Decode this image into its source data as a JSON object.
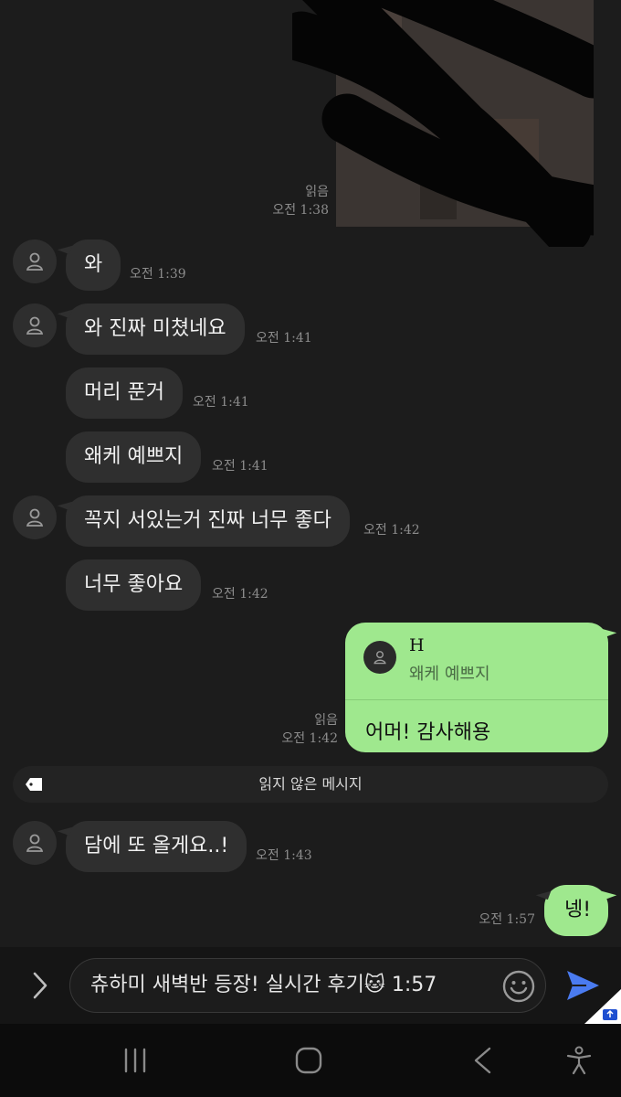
{
  "messages": {
    "m0": {
      "status": "읽음",
      "time": "오전 1:38"
    },
    "m1": {
      "text": "와",
      "time": "오전 1:39"
    },
    "m2": {
      "text": "와 진짜 미쳤네요",
      "time": "오전 1:41"
    },
    "m3": {
      "text": "머리 푼거",
      "time": "오전 1:41"
    },
    "m4": {
      "text": "왜케 예쁘지",
      "time": "오전 1:41"
    },
    "m5": {
      "text": "꼭지 서있는거 진짜 너무 좋다",
      "time": "오전 1:42"
    },
    "m6": {
      "text": "너무 좋아요",
      "time": "오전 1:42"
    },
    "m7": {
      "reply_name": "H",
      "reply_quote": "왜케 예쁘지",
      "text": "어머! 감사해용",
      "status": "읽음",
      "time": "오전 1:42"
    },
    "m8": {
      "text": "담에 또 올게요..!",
      "time": "오전 1:43"
    },
    "m9": {
      "text": "넹!",
      "time": "오전 1:57"
    }
  },
  "unread_divider": "읽지 않은 메시지",
  "composer": {
    "text": "츄하미 새벽반 등장! 실시간 후기🐱 1:57"
  },
  "icons": {
    "avatar": "person-icon",
    "tag": "tag-icon",
    "expand": "chevron-right-icon",
    "emoji": "smiley-icon",
    "send": "send-icon",
    "nav_recent": "recent-apps-icon",
    "nav_home": "home-icon",
    "nav_back": "back-icon",
    "nav_access": "accessibility-icon"
  },
  "colors": {
    "background": "#1c1c1c",
    "incoming_bubble": "#2f2f2f",
    "outgoing_bubble": "#9fe88e",
    "send": "#4a7bf0"
  }
}
